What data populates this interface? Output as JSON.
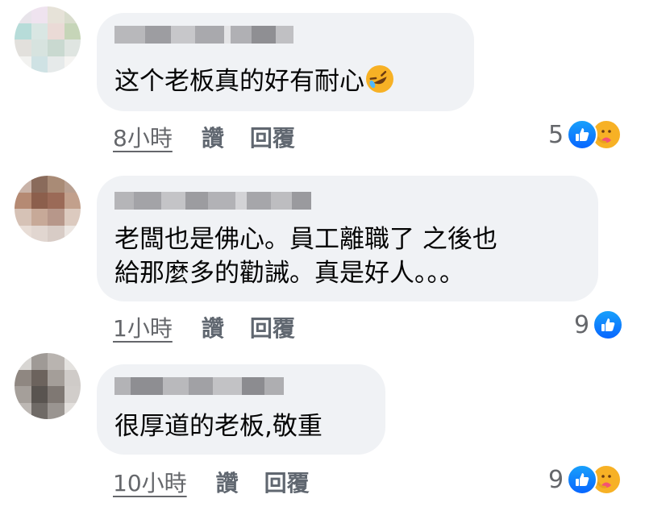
{
  "colors": {
    "bubble": "#f0f2f5",
    "like": "#0866ff",
    "care": "#f7b125",
    "meta_text": "#65676b"
  },
  "comments": [
    {
      "text_lines": [
        "这个老板真的好有耐心"
      ],
      "emoji": "rofl-emoji",
      "time": "8小時",
      "like_label": "讚",
      "reply_label": "回覆",
      "reaction_count": "5",
      "reactions": [
        "like-icon",
        "care-icon"
      ]
    },
    {
      "text_lines": [
        "老闆也是佛心。員工離職了 之後也",
        "給那麼多的勸誡。真是好人。。。"
      ],
      "time": "1小時",
      "like_label": "讚",
      "reply_label": "回覆",
      "reaction_count": "9",
      "reactions": [
        "like-icon"
      ]
    },
    {
      "text_lines": [
        "很厚道的老板,敬重"
      ],
      "time": "10小時",
      "like_label": "讚",
      "reply_label": "回覆",
      "reaction_count": "9",
      "reactions": [
        "like-icon",
        "care-icon"
      ]
    }
  ]
}
